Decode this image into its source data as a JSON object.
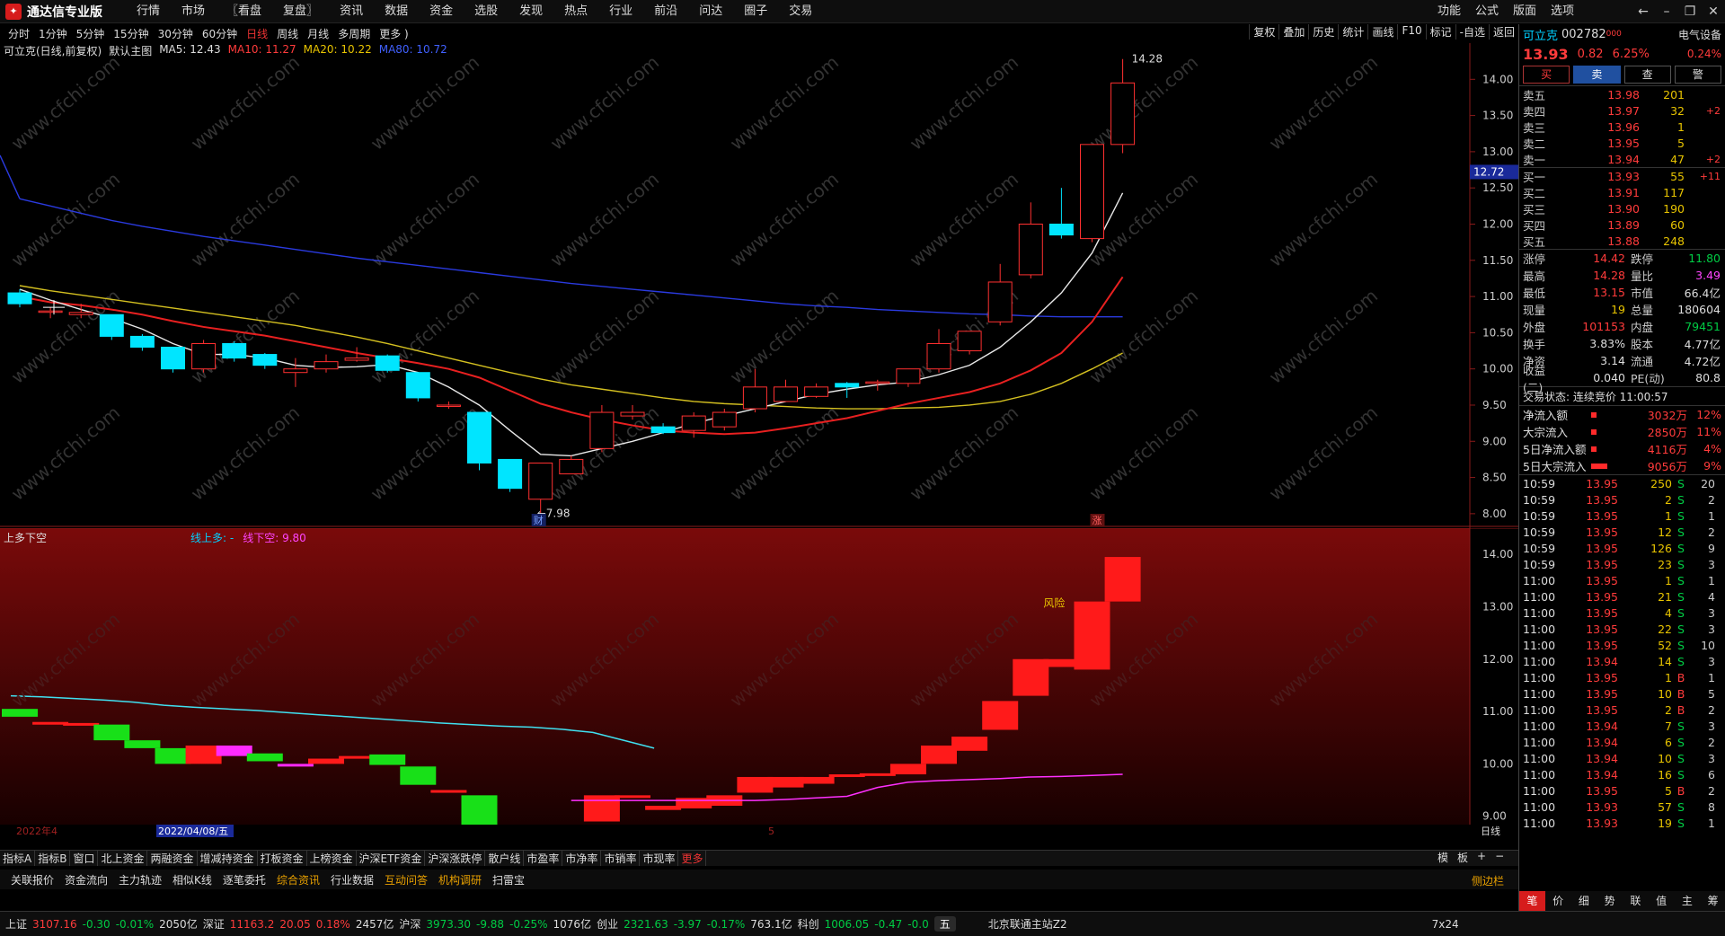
{
  "app": {
    "title": "通达信专业版",
    "menu": [
      "行情",
      "市场",
      "〖看盘",
      "复盘〗",
      "资讯",
      "数据",
      "资金",
      "选股",
      "发现",
      "热点",
      "行业",
      "前沿",
      "问达",
      "圈子",
      "交易"
    ],
    "right_menu": [
      "功能",
      "公式",
      "版面",
      "选项"
    ]
  },
  "periods": [
    "分时",
    "1分钟",
    "5分钟",
    "15分钟",
    "30分钟",
    "60分钟",
    "日线",
    "周线",
    "月线",
    "多周期",
    "更多 )"
  ],
  "tools": [
    "复权",
    "叠加",
    "历史",
    "统计",
    "画线",
    "F10",
    "标记",
    "-自选",
    "返回"
  ],
  "legend": {
    "title": "可立克(日线,前复权)",
    "main": "默认主图",
    "ma5": "MA5: 12.43",
    "ma10": "MA10: 11.27",
    "ma20": "MA20: 10.22",
    "ma80": "MA80: 10.72"
  },
  "sub_legend": {
    "name": "上多下空",
    "l1": "线上多: -",
    "l2": "线下空: 9.80"
  },
  "chart_data": [
    {
      "type": "candlestick",
      "title": "可立克(日线,前复权)",
      "y_ticks": [
        8.0,
        8.5,
        9.0,
        9.5,
        10.0,
        10.5,
        11.0,
        11.5,
        12.0,
        12.5,
        13.0,
        13.5,
        14.0
      ],
      "ylim": [
        7.8,
        14.5
      ],
      "candles": [
        [
          11.05,
          10.9,
          11.1,
          10.85
        ],
        [
          10.8,
          10.8,
          10.85,
          10.7
        ],
        [
          10.75,
          10.78,
          10.9,
          10.7
        ],
        [
          10.75,
          10.45,
          10.75,
          10.4
        ],
        [
          10.45,
          10.3,
          10.48,
          10.25
        ],
        [
          10.3,
          10.0,
          10.3,
          9.95
        ],
        [
          10.0,
          10.35,
          10.4,
          9.95
        ],
        [
          10.35,
          10.15,
          10.38,
          10.1
        ],
        [
          10.2,
          10.05,
          10.22,
          10.0
        ],
        [
          9.95,
          10.0,
          10.15,
          9.75
        ],
        [
          10.0,
          10.1,
          10.2,
          9.95
        ],
        [
          10.12,
          10.15,
          10.3,
          10.1
        ],
        [
          10.18,
          9.98,
          10.2,
          9.95
        ],
        [
          9.95,
          9.6,
          9.95,
          9.55
        ],
        [
          9.5,
          9.5,
          9.55,
          9.45
        ],
        [
          9.4,
          8.7,
          9.4,
          8.6
        ],
        [
          8.75,
          8.35,
          8.75,
          8.3
        ],
        [
          8.2,
          8.7,
          8.7,
          7.98
        ],
        [
          8.55,
          8.75,
          8.8,
          8.55
        ],
        [
          8.9,
          9.4,
          9.5,
          8.85
        ],
        [
          9.35,
          9.4,
          9.5,
          9.3
        ],
        [
          9.2,
          9.12,
          9.25,
          9.1
        ],
        [
          9.15,
          9.35,
          9.4,
          9.05
        ],
        [
          9.2,
          9.4,
          9.45,
          9.15
        ],
        [
          9.45,
          9.75,
          10.0,
          9.4
        ],
        [
          9.55,
          9.75,
          9.85,
          9.55
        ],
        [
          9.62,
          9.75,
          9.8,
          9.6
        ],
        [
          9.8,
          9.75,
          9.82,
          9.6
        ],
        [
          9.8,
          9.82,
          9.85,
          9.7
        ],
        [
          9.8,
          10.0,
          10.0,
          9.75
        ],
        [
          10.0,
          10.35,
          10.55,
          9.95
        ],
        [
          10.25,
          10.52,
          10.52,
          10.2
        ],
        [
          10.65,
          11.2,
          11.45,
          10.6
        ],
        [
          11.3,
          12.0,
          12.3,
          11.25
        ],
        [
          12.0,
          11.85,
          12.5,
          11.8
        ],
        [
          11.8,
          13.1,
          13.1,
          11.75
        ],
        [
          13.1,
          13.95,
          14.28,
          12.98
        ]
      ],
      "ma5": [
        11.1,
        10.95,
        10.82,
        10.7,
        10.55,
        10.35,
        10.2,
        10.2,
        10.15,
        10.05,
        10.02,
        10.03,
        10.06,
        9.95,
        9.75,
        9.5,
        9.15,
        8.82,
        8.8,
        8.9,
        9.0,
        9.12,
        9.25,
        9.35,
        9.45,
        9.55,
        9.65,
        9.72,
        9.78,
        9.82,
        9.92,
        10.05,
        10.3,
        10.65,
        11.05,
        11.6,
        12.43
      ],
      "ma10": [
        11.0,
        10.92,
        10.88,
        10.82,
        10.75,
        10.66,
        10.58,
        10.52,
        10.46,
        10.38,
        10.3,
        10.22,
        10.15,
        10.08,
        10.0,
        9.88,
        9.7,
        9.52,
        9.4,
        9.3,
        9.22,
        9.15,
        9.12,
        9.1,
        9.12,
        9.18,
        9.25,
        9.32,
        9.42,
        9.52,
        9.6,
        9.68,
        9.8,
        9.98,
        10.22,
        10.65,
        11.27
      ],
      "ma20": [
        11.15,
        11.08,
        11.02,
        10.96,
        10.9,
        10.84,
        10.78,
        10.72,
        10.66,
        10.6,
        10.52,
        10.44,
        10.35,
        10.25,
        10.15,
        10.05,
        9.95,
        9.86,
        9.78,
        9.72,
        9.66,
        9.6,
        9.55,
        9.52,
        9.5,
        9.48,
        9.46,
        9.45,
        9.45,
        9.46,
        9.47,
        9.5,
        9.55,
        9.65,
        9.8,
        10.0,
        10.22
      ],
      "ma80": [
        12.35,
        12.25,
        12.15,
        12.05,
        11.97,
        11.9,
        11.83,
        11.77,
        11.71,
        11.65,
        11.59,
        11.53,
        11.48,
        11.43,
        11.38,
        11.33,
        11.28,
        11.23,
        11.18,
        11.14,
        11.1,
        11.06,
        11.02,
        10.98,
        10.94,
        10.9,
        10.87,
        10.85,
        10.82,
        10.8,
        10.78,
        10.76,
        10.75,
        10.73,
        10.72,
        10.72,
        10.72
      ],
      "annotations": {
        "high": "14.28",
        "low": "←7.98",
        "price_tag": "12.72",
        "marker_cai": "财",
        "marker_zhang": "涨"
      }
    },
    {
      "type": "bar",
      "title": "上多下空",
      "y_ticks": [
        9.0,
        10.0,
        11.0,
        12.0,
        13.0,
        14.0
      ],
      "ylim": [
        8.6,
        14.5
      ],
      "line_up": [
        11.3,
        11.28,
        11.25,
        11.22,
        11.18,
        11.12,
        11.08,
        11.05,
        11.02,
        10.98,
        10.94,
        10.9,
        10.86,
        10.82,
        10.78,
        10.75,
        10.72,
        10.7,
        10.66,
        10.6,
        10.45,
        10.3
      ],
      "line_down": [
        9.3,
        9.3,
        9.3,
        9.3,
        9.3,
        9.3,
        9.3,
        9.32,
        9.35,
        9.38,
        9.55,
        9.65,
        9.68,
        9.7,
        9.72,
        9.75,
        9.76,
        9.78,
        9.8
      ],
      "risk_label": "风险"
    }
  ],
  "price_tag": "12.72",
  "date_label": "2022/04/08/五",
  "date_left": "2022年4",
  "month_5": "5",
  "day_label": "日线",
  "bottom_tabs": [
    "指标A",
    "指标B",
    "窗口",
    "北上资金",
    "两融资金",
    "增减持资金",
    "打板资金",
    "上榜资金",
    "沪深ETF资金",
    "沪深涨跌停",
    "散户线",
    "市盈率",
    "市净率",
    "市销率",
    "市现率",
    "更多"
  ],
  "bottom_right": [
    "模",
    "板",
    "+",
    "−"
  ],
  "function_tabs": [
    "关联报价",
    "资金流向",
    "主力轨迹",
    "相似K线",
    "逐笔委托",
    "综合资讯",
    "行业数据",
    "互动问答",
    "机构调研",
    "扫雷宝"
  ],
  "side_bar": "侧边栏",
  "status": {
    "sh": "上证",
    "sh_v": "3107.16",
    "sh_c": "-0.30",
    "sh_p": "-0.01%",
    "sh_a": "2050亿",
    "sz": "深证",
    "sz_v": "11163.2",
    "sz_c": "20.05",
    "sz_p": "0.18%",
    "sz_a": "2457亿",
    "hs": "沪深",
    "hs_v": "3973.30",
    "hs_c": "-9.88",
    "hs_p": "-0.25%",
    "hs_a": "1076亿",
    "cy": "创业",
    "cy_v": "2321.63",
    "cy_c": "-3.97",
    "cy_p": "-0.17%",
    "cy_a": "763.1亿",
    "kc": "科创",
    "kc_v": "1006.05",
    "kc_c": "-0.47",
    "kc_p": "-0.0",
    "ime": "五",
    "server": "北京联通主站Z2",
    "mode": "7x24"
  },
  "quote": {
    "name": "可立克",
    "code": "002782",
    "code_sfx": "000",
    "sector": "电气设备",
    "price": "13.93",
    "chg": "0.82",
    "pct": "6.25%",
    "pct2": "0.24%",
    "btns": [
      "买",
      "卖",
      "查",
      "警"
    ]
  },
  "asks": [
    [
      "卖五",
      "13.98",
      "201",
      ""
    ],
    [
      "卖四",
      "13.97",
      "32",
      "+2"
    ],
    [
      "卖三",
      "13.96",
      "1",
      ""
    ],
    [
      "卖二",
      "13.95",
      "5",
      ""
    ],
    [
      "卖一",
      "13.94",
      "47",
      "+2"
    ]
  ],
  "bids": [
    [
      "买一",
      "13.93",
      "55",
      "+11"
    ],
    [
      "买二",
      "13.91",
      "117",
      ""
    ],
    [
      "买三",
      "13.90",
      "190",
      ""
    ],
    [
      "买四",
      "13.89",
      "60",
      ""
    ],
    [
      "买五",
      "13.88",
      "248",
      ""
    ]
  ],
  "stats": [
    [
      "涨停",
      "14.42",
      "跌停",
      "11.80"
    ],
    [
      "最高",
      "14.28",
      "量比",
      "3.49"
    ],
    [
      "最低",
      "13.15",
      "市值",
      "66.4亿"
    ],
    [
      "现量",
      "19",
      "总量",
      "180604"
    ],
    [
      "外盘",
      "101153",
      "内盘",
      "79451"
    ],
    [
      "换手",
      "3.83%",
      "股本",
      "4.77亿"
    ],
    [
      "净资",
      "3.14",
      "流通",
      "4.72亿"
    ],
    [
      "收益(二)",
      "0.040",
      "PE(动)",
      "80.8"
    ]
  ],
  "trade_state": "交易状态: 连续竞价 11:00:57",
  "flows": [
    [
      "净流入额",
      "3032万",
      "12%"
    ],
    [
      "大宗流入",
      "2850万",
      "11%"
    ],
    [
      "5日净流入额",
      "4116万",
      "4%"
    ],
    [
      "5日大宗流入",
      "9056万",
      "9%"
    ]
  ],
  "ticks": [
    [
      "10:59",
      "13.95",
      "250",
      "S",
      "20"
    ],
    [
      "10:59",
      "13.95",
      "2",
      "S",
      "2"
    ],
    [
      "10:59",
      "13.95",
      "1",
      "S",
      "1"
    ],
    [
      "10:59",
      "13.95",
      "12",
      "S",
      "2"
    ],
    [
      "10:59",
      "13.95",
      "126",
      "S",
      "9"
    ],
    [
      "10:59",
      "13.95",
      "23",
      "S",
      "3"
    ],
    [
      "11:00",
      "13.95",
      "1",
      "S",
      "1"
    ],
    [
      "11:00",
      "13.95",
      "21",
      "S",
      "4"
    ],
    [
      "11:00",
      "13.95",
      "4",
      "S",
      "3"
    ],
    [
      "11:00",
      "13.95",
      "22",
      "S",
      "3"
    ],
    [
      "11:00",
      "13.95",
      "52",
      "S",
      "10"
    ],
    [
      "11:00",
      "13.94",
      "14",
      "S",
      "3"
    ],
    [
      "11:00",
      "13.95",
      "1",
      "B",
      "1"
    ],
    [
      "11:00",
      "13.95",
      "10",
      "B",
      "5"
    ],
    [
      "11:00",
      "13.95",
      "2",
      "B",
      "2"
    ],
    [
      "11:00",
      "13.94",
      "7",
      "S",
      "3"
    ],
    [
      "11:00",
      "13.94",
      "6",
      "S",
      "2"
    ],
    [
      "11:00",
      "13.94",
      "10",
      "S",
      "3"
    ],
    [
      "11:00",
      "13.94",
      "16",
      "S",
      "6"
    ],
    [
      "11:00",
      "13.95",
      "5",
      "B",
      "2"
    ],
    [
      "11:00",
      "13.93",
      "57",
      "S",
      "8"
    ],
    [
      "11:00",
      "13.93",
      "19",
      "S",
      "1"
    ]
  ],
  "right_tabs": [
    "笔",
    "价",
    "细",
    "势",
    "联",
    "值",
    "主",
    "筹"
  ],
  "watermark": "www.cfchi.com"
}
